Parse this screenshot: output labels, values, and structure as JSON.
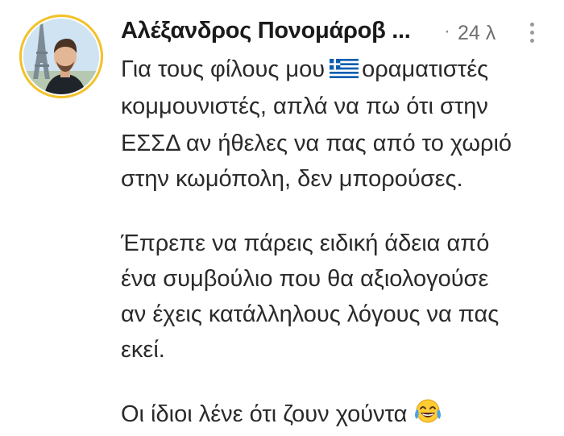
{
  "post": {
    "author": "Αλέξανδρος Πονομάροβ ...",
    "separator": "·",
    "time": "24 λ",
    "more_icon": "vertical-ellipsis-icon",
    "lines": [
      {
        "before": "Για τους φίλους μου",
        "flag": "greece-flag-icon",
        "after": "οραματιστές"
      },
      "κομμουνιστές, απλά να πω ότι στην",
      "ΕΣΣΔ αν ήθελες να πας από το χωριό",
      "στην κωμόπολη, δεν μπορούσες.",
      "Έπρεπε να πάρεις ειδική άδεια από",
      "ένα συμβούλιο που θα αξιολογούσε",
      "αν έχεις κατάλληλους λόγους να πας",
      "εκεί.",
      {
        "text": "Οι ίδιοι λένε ότι ζουν χούντα",
        "emoji": "tears-of-joy-icon"
      }
    ],
    "colors": {
      "avatar_ring": "#f3c12b",
      "flag_blue": "#0d5eaf",
      "text": "#2a2a2a",
      "meta": "#707070"
    }
  }
}
